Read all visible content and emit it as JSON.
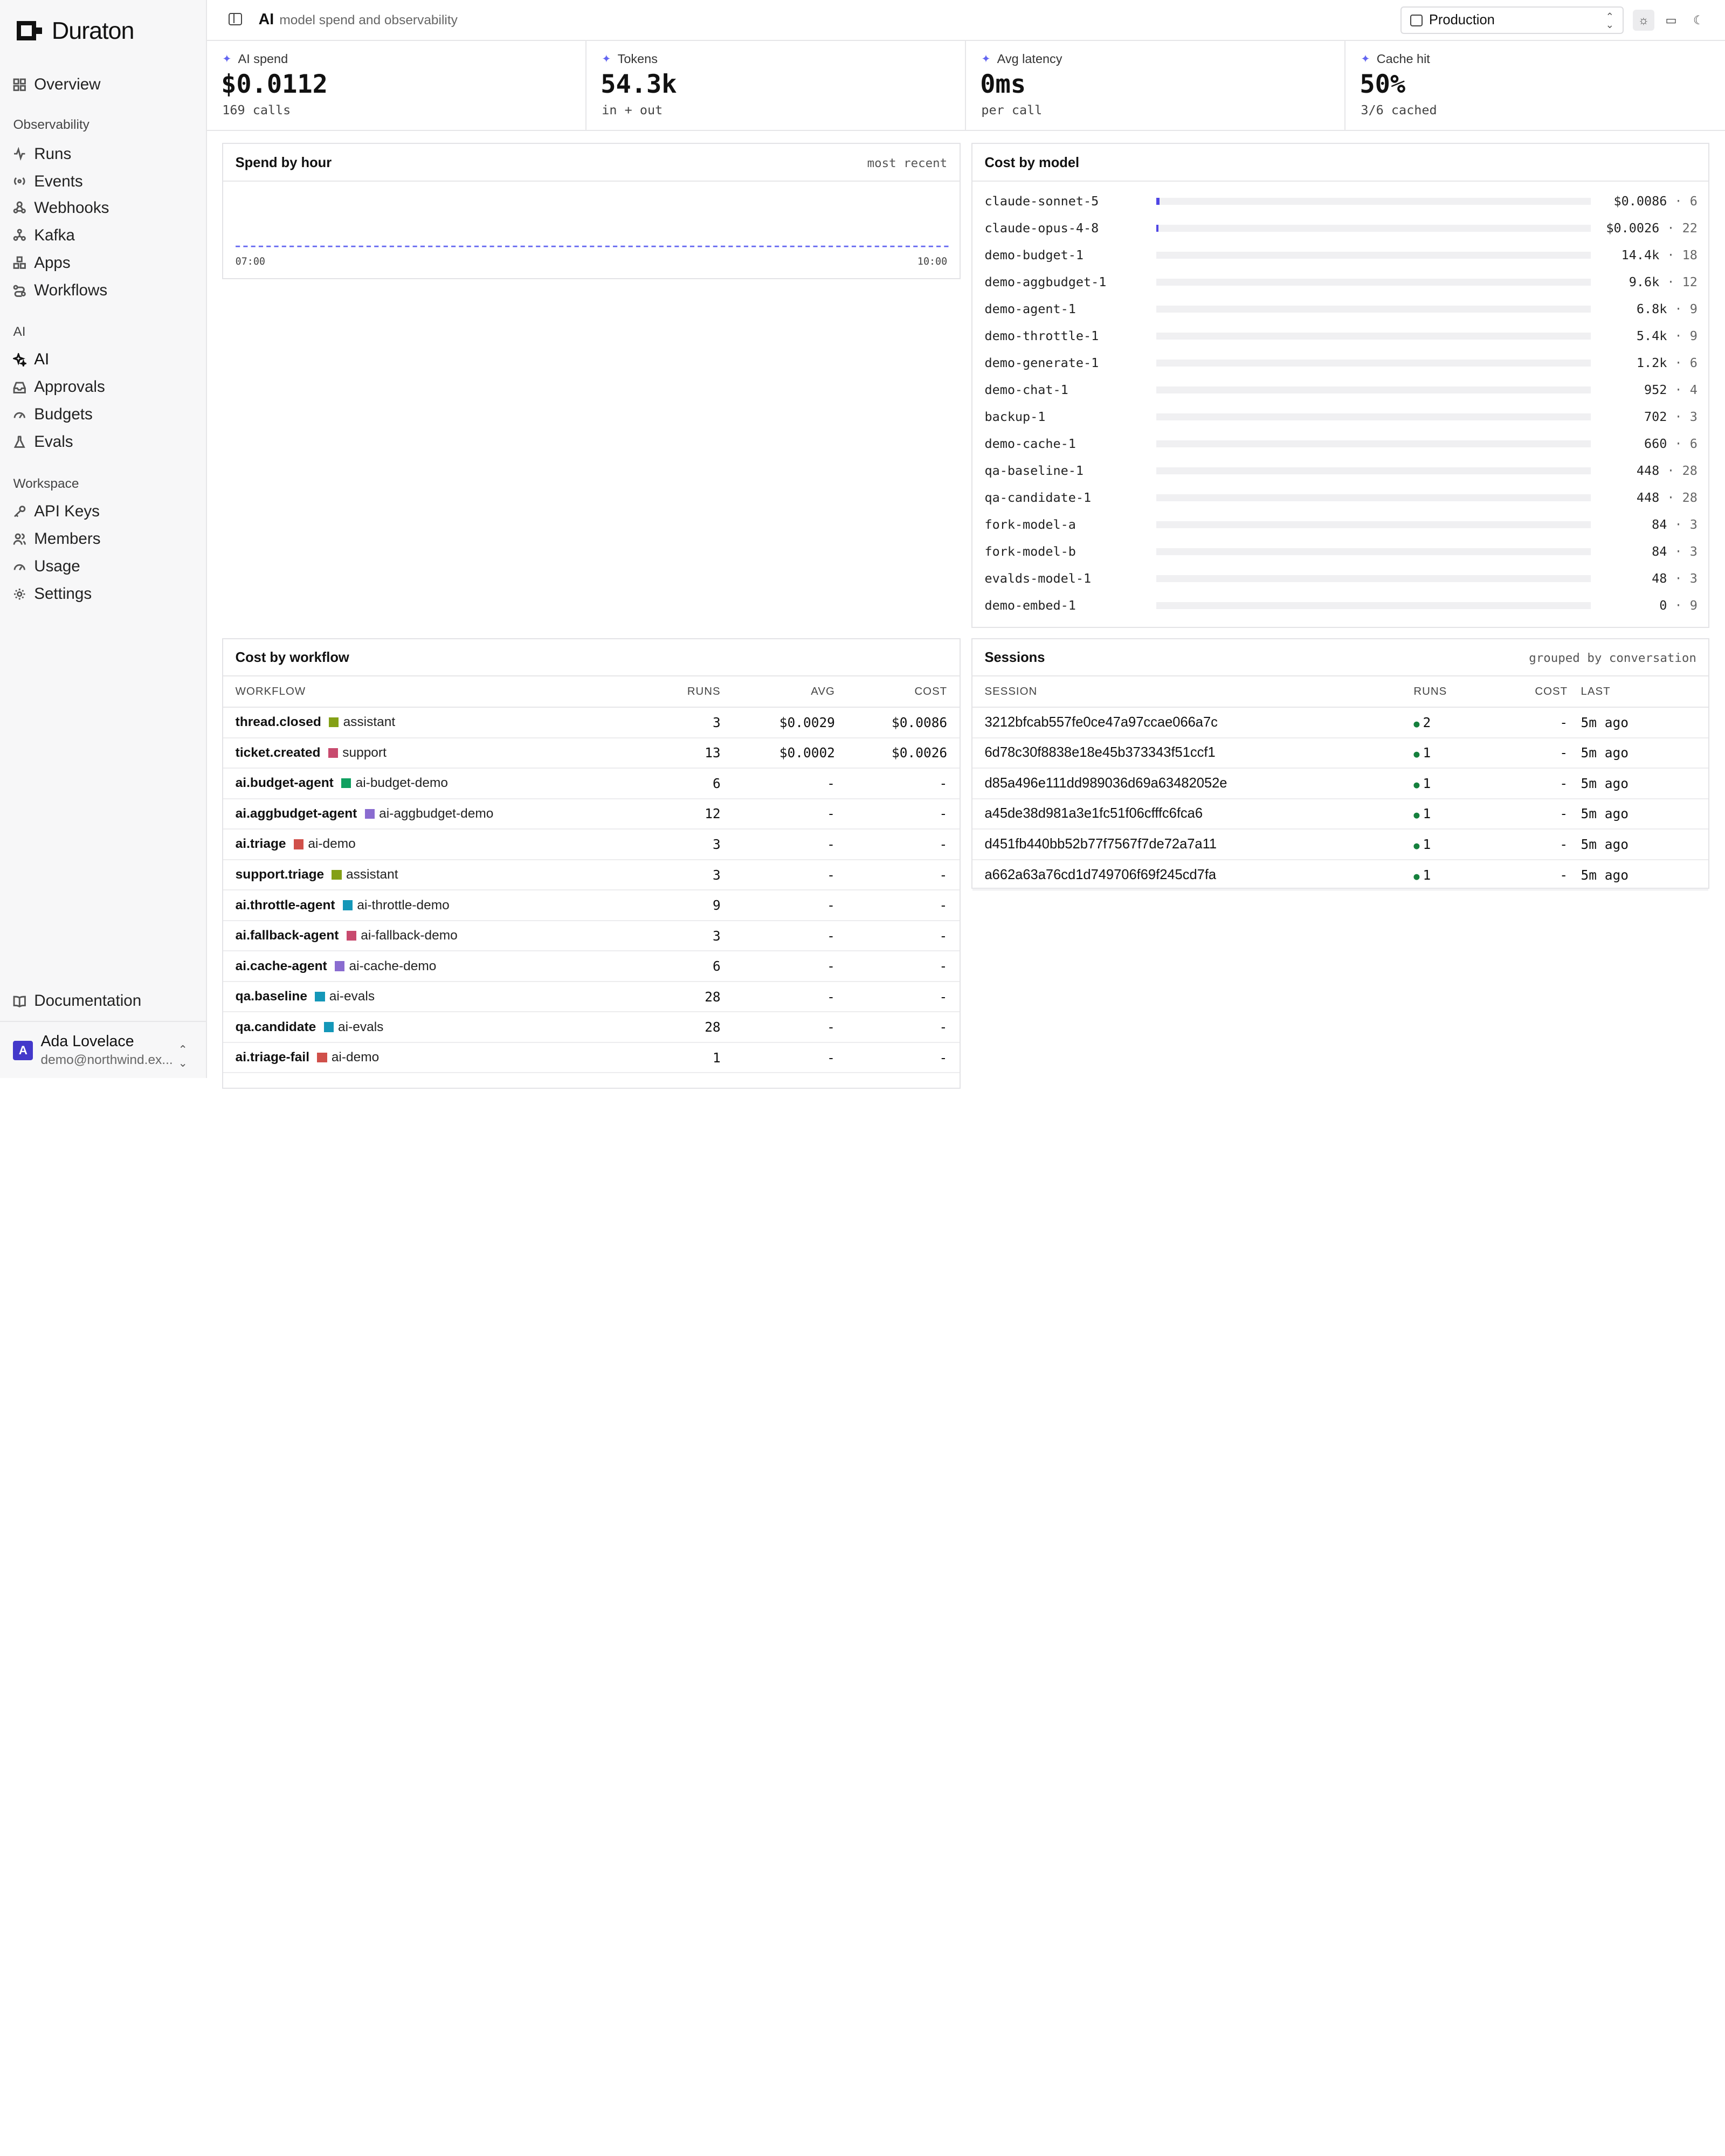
{
  "brand": {
    "name": "Duraton"
  },
  "sidebar": {
    "overview": "Overview",
    "sections": [
      {
        "title": "Observability",
        "items": [
          "Runs",
          "Events",
          "Webhooks",
          "Kafka",
          "Apps",
          "Workflows"
        ]
      },
      {
        "title": "AI",
        "items": [
          "AI",
          "Approvals",
          "Budgets",
          "Evals"
        ]
      },
      {
        "title": "Workspace",
        "items": [
          "API Keys",
          "Members",
          "Usage",
          "Settings"
        ]
      }
    ],
    "documentation": "Documentation",
    "user": {
      "initial": "A",
      "name": "Ada Lovelace",
      "email": "demo@northwind.ex..."
    }
  },
  "topbar": {
    "title": "AI",
    "subtitle": "model spend and observability",
    "environment": "Production"
  },
  "stats": [
    {
      "label": "AI spend",
      "value": "$0.0112",
      "sub": "169 calls"
    },
    {
      "label": "Tokens",
      "value": "54.3k",
      "sub": "in + out"
    },
    {
      "label": "Avg latency",
      "value": "0ms",
      "sub": "per call"
    },
    {
      "label": "Cache hit",
      "value": "50%",
      "sub": "3/6 cached"
    }
  ],
  "spend_by_hour": {
    "title": "Spend by hour",
    "note": "most recent",
    "x_start": "07:00",
    "x_end": "10:00"
  },
  "cost_by_model": {
    "title": "Cost by model",
    "rows": [
      {
        "model": "claude-sonnet-5",
        "value": "$0.0086",
        "count": "6",
        "share": 0.008
      },
      {
        "model": "claude-opus-4-8",
        "value": "$0.0026",
        "count": "22",
        "share": 0.003
      },
      {
        "model": "demo-budget-1",
        "value": "14.4k",
        "count": "18",
        "share": 0
      },
      {
        "model": "demo-aggbudget-1",
        "value": "9.6k",
        "count": "12",
        "share": 0
      },
      {
        "model": "demo-agent-1",
        "value": "6.8k",
        "count": "9",
        "share": 0
      },
      {
        "model": "demo-throttle-1",
        "value": "5.4k",
        "count": "9",
        "share": 0
      },
      {
        "model": "demo-generate-1",
        "value": "1.2k",
        "count": "6",
        "share": 0
      },
      {
        "model": "demo-chat-1",
        "value": "952",
        "count": "4",
        "share": 0
      },
      {
        "model": "backup-1",
        "value": "702",
        "count": "3",
        "share": 0
      },
      {
        "model": "demo-cache-1",
        "value": "660",
        "count": "6",
        "share": 0
      },
      {
        "model": "qa-baseline-1",
        "value": "448",
        "count": "28",
        "share": 0
      },
      {
        "model": "qa-candidate-1",
        "value": "448",
        "count": "28",
        "share": 0
      },
      {
        "model": "fork-model-a",
        "value": "84",
        "count": "3",
        "share": 0
      },
      {
        "model": "fork-model-b",
        "value": "84",
        "count": "3",
        "share": 0
      },
      {
        "model": "evalds-model-1",
        "value": "48",
        "count": "3",
        "share": 0
      },
      {
        "model": "demo-embed-1",
        "value": "0",
        "count": "9",
        "share": 0
      }
    ]
  },
  "cost_by_workflow": {
    "title": "Cost by workflow",
    "columns": [
      "WORKFLOW",
      "RUNS",
      "AVG",
      "COST"
    ],
    "rows": [
      {
        "workflow": "thread.closed",
        "app": "assistant",
        "color": "#84a016",
        "runs": "3",
        "avg": "$0.0029",
        "cost": "$0.0086"
      },
      {
        "workflow": "ticket.created",
        "app": "support",
        "color": "#c84a6e",
        "runs": "13",
        "avg": "$0.0002",
        "cost": "$0.0026"
      },
      {
        "workflow": "ai.budget-agent",
        "app": "ai-budget-demo",
        "color": "#10a060",
        "runs": "6",
        "avg": "-",
        "cost": "-"
      },
      {
        "workflow": "ai.aggbudget-agent",
        "app": "ai-aggbudget-demo",
        "color": "#8a6cd0",
        "runs": "12",
        "avg": "-",
        "cost": "-"
      },
      {
        "workflow": "ai.triage",
        "app": "ai-demo",
        "color": "#d0504a",
        "runs": "3",
        "avg": "-",
        "cost": "-"
      },
      {
        "workflow": "support.triage",
        "app": "assistant",
        "color": "#84a016",
        "runs": "3",
        "avg": "-",
        "cost": "-"
      },
      {
        "workflow": "ai.throttle-agent",
        "app": "ai-throttle-demo",
        "color": "#1497b8",
        "runs": "9",
        "avg": "-",
        "cost": "-"
      },
      {
        "workflow": "ai.fallback-agent",
        "app": "ai-fallback-demo",
        "color": "#c84a6e",
        "runs": "3",
        "avg": "-",
        "cost": "-"
      },
      {
        "workflow": "ai.cache-agent",
        "app": "ai-cache-demo",
        "color": "#8a6cd0",
        "runs": "6",
        "avg": "-",
        "cost": "-"
      },
      {
        "workflow": "qa.baseline",
        "app": "ai-evals",
        "color": "#1497b8",
        "runs": "28",
        "avg": "-",
        "cost": "-"
      },
      {
        "workflow": "qa.candidate",
        "app": "ai-evals",
        "color": "#1497b8",
        "runs": "28",
        "avg": "-",
        "cost": "-"
      },
      {
        "workflow": "ai.triage-fail",
        "app": "ai-demo",
        "color": "#d0504a",
        "runs": "1",
        "avg": "-",
        "cost": "-"
      }
    ]
  },
  "sessions": {
    "title": "Sessions",
    "note": "grouped by conversation",
    "columns": [
      "SESSION",
      "RUNS",
      "COST",
      "LAST"
    ],
    "rows": [
      {
        "session": "3212bfcab557fe0ce47a97ccae066a7c",
        "runs": "2",
        "cost": "-",
        "last": "5m ago"
      },
      {
        "session": "6d78c30f8838e18e45b373343f51ccf1",
        "runs": "1",
        "cost": "-",
        "last": "5m ago"
      },
      {
        "session": "d85a496e111dd989036d69a63482052e",
        "runs": "1",
        "cost": "-",
        "last": "5m ago"
      },
      {
        "session": "a45de38d981a3e1fc51f06cfffc6fca6",
        "runs": "1",
        "cost": "-",
        "last": "5m ago"
      },
      {
        "session": "d451fb440bb52b77f7567f7de72a7a11",
        "runs": "1",
        "cost": "-",
        "last": "5m ago"
      },
      {
        "session": "a662a63a76cd1d749706f69f245cd7fa",
        "runs": "1",
        "cost": "-",
        "last": "5m ago"
      }
    ]
  }
}
